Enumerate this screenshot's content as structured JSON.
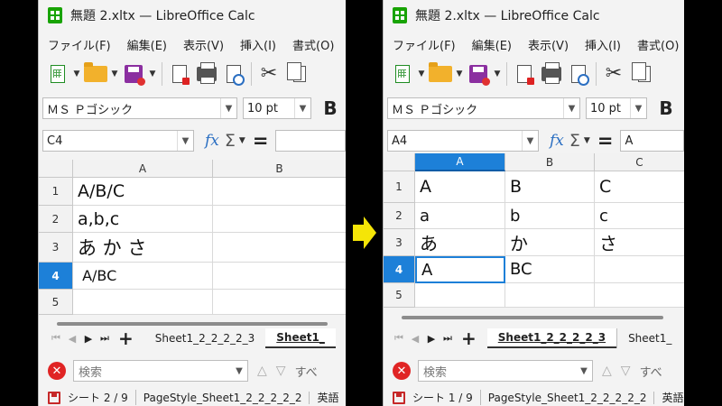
{
  "accent_color": "#1d80d8",
  "arrow_color": "#f5e507",
  "left": {
    "window_title": "無題 2.xltx — LibreOffice Calc",
    "menu": [
      "ファイル(F)",
      "編集(E)",
      "表示(V)",
      "挿入(I)",
      "書式(O)"
    ],
    "font_name": "ＭＳ Ｐゴシック",
    "font_size": "10 pt",
    "bold_label": "B",
    "name_box": "C4",
    "formula_value": "",
    "columns": [
      "A",
      "B"
    ],
    "rows": [
      "1",
      "2",
      "3",
      "4",
      "5"
    ],
    "cells": [
      "A/B/C",
      "a,b,c",
      "あ か さ",
      " A/BC",
      ""
    ],
    "sheet_tabs": [
      "Sheet1_2_2_2_2_3",
      "Sheet1_"
    ],
    "search_placeholder": "検索",
    "find_all_label": "すべ",
    "status": [
      "シート 2 / 9",
      "PageStyle_Sheet1_2_2_2_2_2",
      "英語"
    ]
  },
  "right": {
    "window_title": "無題 2.xltx — LibreOffice Calc",
    "menu": [
      "ファイル(F)",
      "編集(E)",
      "表示(V)",
      "挿入(I)",
      "書式(O)"
    ],
    "font_name": "ＭＳ Ｐゴシック",
    "font_size": "10 pt",
    "bold_label": "B",
    "name_box": "A4",
    "formula_value": "A",
    "columns": [
      "A",
      "B",
      "C"
    ],
    "rows": [
      "1",
      "2",
      "3",
      "4",
      "5"
    ],
    "cells": [
      [
        "A",
        "B",
        "C"
      ],
      [
        "a",
        "b",
        "c"
      ],
      [
        "あ",
        "か",
        "さ"
      ],
      [
        "A",
        "BC",
        ""
      ],
      [
        "",
        "",
        ""
      ]
    ],
    "sheet_tabs": [
      "Sheet1_2_2_2_2_3",
      "Sheet1_"
    ],
    "search_placeholder": "検索",
    "find_all_label": "すべ",
    "status": [
      "シート 1 / 9",
      "PageStyle_Sheet1_2_2_2_2_2",
      "英語"
    ]
  }
}
